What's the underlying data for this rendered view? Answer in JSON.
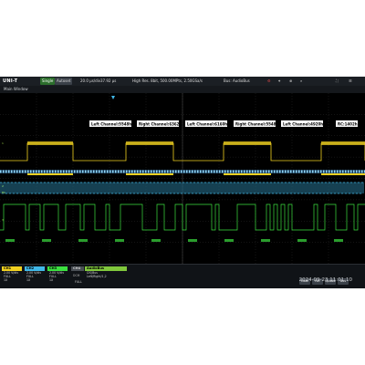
{
  "topbar": {
    "logo": "UNI-T",
    "mode": "Single",
    "autoset": "Autoset",
    "timebase": "20.0 µs/div",
    "offset": "37.92 µs",
    "acquire": "High Res. 8bit, 500.00MPts, 2.50GSa/s",
    "trigger": "Bus: AudioBus",
    "icons": [
      "gear-icon",
      "cursor-icon",
      "zoom-icon",
      "search-icon",
      "fullscreen-icon",
      "menu-icon"
    ]
  },
  "window": {
    "title": "Main Window"
  },
  "decode_labels": [
    "Left Channel:5548h",
    "Right Channel:6362h",
    "Left Channel:6160h",
    "Right Channel:5548h",
    "Left Channel:4920h",
    "RC:1402h"
  ],
  "bus_label": "B1",
  "channels": [
    {
      "name": "CH1",
      "coupling": "DC",
      "scale": "2.00 V/div",
      "bw": "FULL",
      "probe": "1X",
      "color": "#f0d020"
    },
    {
      "name": "CH2",
      "coupling": "DC",
      "scale": "2.00 V/div",
      "bw": "FULL",
      "probe": "1X",
      "color": "#40b8e8"
    },
    {
      "name": "CH3",
      "coupling": "DC",
      "scale": "2.00 V/div",
      "bw": "FULL",
      "probe": "1X",
      "color": "#3ce040"
    }
  ],
  "off_channels": [
    "CH4",
    "DCM"
  ],
  "bus_panel": {
    "name": "AudioBus",
    "type": "I2S/Bus",
    "source": "Left/Right/1,2",
    "scale": "500 ms/div",
    "mode": "FULL",
    "probe": "1X"
  },
  "softkeys": [
    "Math",
    "Ref",
    "Update",
    "Bus"
  ],
  "datetime": "2024-09-23  11:01:10",
  "colors": {
    "background": "#000000",
    "ch1": "#f0d020",
    "ch2": "#40b8e8",
    "ch3": "#3ce040",
    "accent": "#80c83c"
  }
}
